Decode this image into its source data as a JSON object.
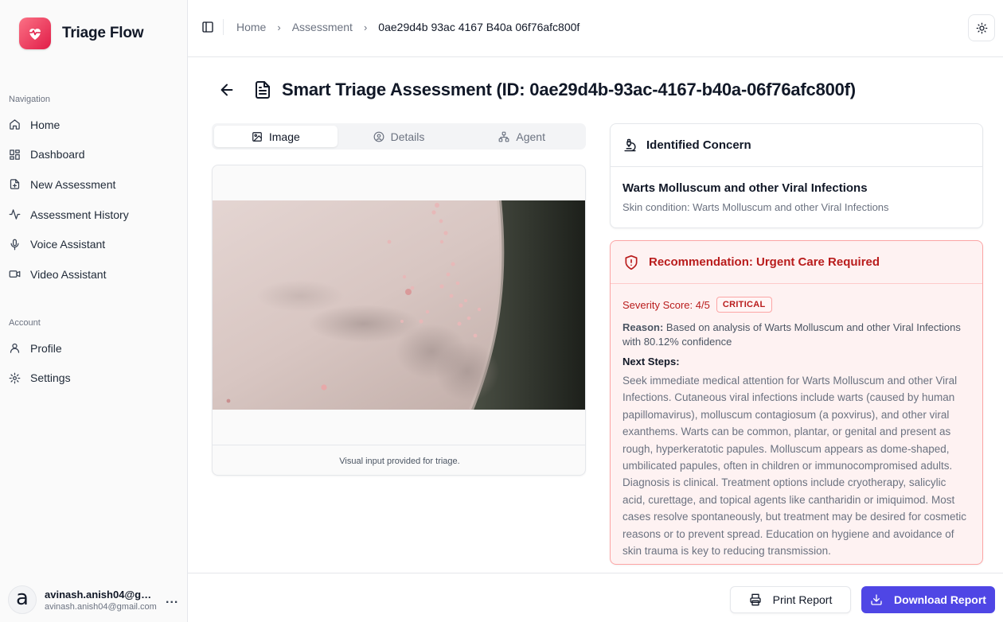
{
  "app": {
    "name": "Triage Flow",
    "brand_color": "#e11d48",
    "logo_icon": "heart-pulse-icon"
  },
  "sidebar": {
    "navigation_label": "Navigation",
    "nav_items": [
      {
        "label": "Home",
        "icon": "home-icon"
      },
      {
        "label": "Dashboard",
        "icon": "dashboard-icon"
      },
      {
        "label": "New Assessment",
        "icon": "file-plus-icon"
      },
      {
        "label": "Assessment History",
        "icon": "activity-icon"
      },
      {
        "label": "Voice Assistant",
        "icon": "mic-icon"
      },
      {
        "label": "Video Assistant",
        "icon": "video-icon"
      }
    ],
    "account_label": "Account",
    "account_items": [
      {
        "label": "Profile",
        "icon": "user-icon"
      },
      {
        "label": "Settings",
        "icon": "settings-icon"
      }
    ],
    "user": {
      "avatar_letter": "a",
      "name": "avinash.anish04@gmail.com",
      "email": "avinash.anish04@gmail.com",
      "more": "..."
    }
  },
  "header": {
    "breadcrumb": [
      "Home",
      "Assessment",
      "0ae29d4b 93ac 4167 B40a 06f76afc800f"
    ]
  },
  "page": {
    "title": "Smart Triage Assessment (ID: 0ae29d4b-93ac-4167-b40a-06f76afc800f)",
    "tabs": [
      {
        "label": "Image",
        "icon": "image-icon",
        "active": true
      },
      {
        "label": "Details",
        "icon": "user-circle-icon",
        "active": false
      },
      {
        "label": "Agent",
        "icon": "network-icon",
        "active": false
      }
    ],
    "image_caption": "Visual input provided for triage."
  },
  "concern": {
    "heading": "Identified Concern",
    "title": "Warts Molluscum and other Viral Infections",
    "subtitle": "Skin condition: Warts Molluscum and other Viral Infections"
  },
  "recommendation": {
    "heading": "Recommendation: Urgent Care Required",
    "severity": "Severity Score: 4/5",
    "badge": "CRITICAL",
    "reason_label": "Reason:",
    "reason": "Based on analysis of Warts Molluscum and other Viral Infections with 80.12% confidence",
    "next_steps_label": "Next Steps:",
    "next_steps": "Seek immediate medical attention for Warts Molluscum and other Viral Infections. Cutaneous viral infections include warts (caused by human papillomavirus), molluscum contagiosum (a poxvirus), and other viral exanthems. Warts can be common, plantar, or genital and present as rough, hyperkeratotic papules. Molluscum appears as dome-shaped, umbilicated papules, often in children or immunocompromised adults. Diagnosis is clinical. Treatment options include cryotherapy, salicylic acid, curettage, and topical agents like cantharidin or imiquimod. Most cases resolve spontaneously, but treatment may be desired for cosmetic reasons or to prevent spread. Education on hygiene and avoidance of skin trauma is key to reducing transmission.",
    "accent_color": "#b91c1c"
  },
  "footer": {
    "print_label": "Print Report",
    "download_label": "Download Report",
    "download_color": "#4f46e5"
  }
}
